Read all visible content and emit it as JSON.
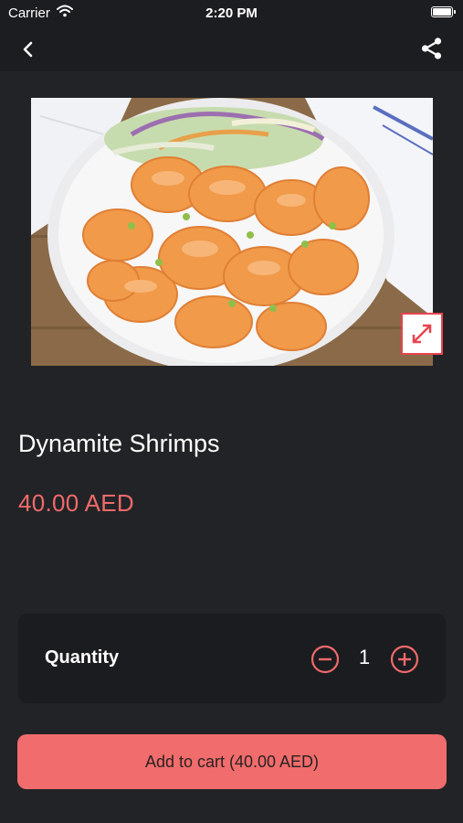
{
  "status_bar": {
    "carrier": "Carrier",
    "time": "2:20 PM",
    "icons": [
      "wifi-icon",
      "battery-icon"
    ]
  },
  "nav": {
    "icons": [
      "back-chevron-icon",
      "share-icon"
    ]
  },
  "product": {
    "title": "Dynamite Shrimps",
    "price": "40.00 AED",
    "image_icon": "expand-icon"
  },
  "quantity": {
    "label": "Quantity",
    "value": "1",
    "icons": [
      "minus-circle-icon",
      "plus-circle-icon"
    ]
  },
  "cart_button": {
    "label": "Add to cart (40.00 AED)"
  },
  "colors": {
    "background": "#222326",
    "accent": "#f06a6a",
    "card": "#1b1c1f"
  }
}
